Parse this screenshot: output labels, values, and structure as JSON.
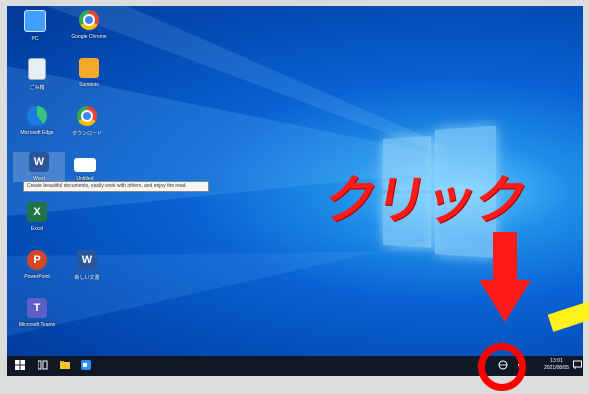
{
  "desktop": {
    "icons": [
      {
        "label": "PC",
        "icon": "pc-icon"
      },
      {
        "label": "Google Chrome",
        "icon": "chrome-icon"
      },
      {
        "label": "ごみ箱",
        "icon": "recycle-bin-icon"
      },
      {
        "label": "Sumitoto",
        "icon": "folder-app-icon"
      },
      {
        "label": "Microsoft Edge",
        "icon": "edge-icon"
      },
      {
        "label": "ダウンロード",
        "icon": "chrome-icon"
      },
      {
        "label": "Word",
        "icon": "word-icon"
      },
      {
        "label": "Untitled",
        "icon": "blank-document-icon"
      },
      {
        "label": "Excel",
        "icon": "excel-icon"
      },
      {
        "label": "PowerPoint",
        "icon": "powerpoint-icon"
      },
      {
        "label": "新しい文書",
        "icon": "word-doc-icon"
      },
      {
        "label": "Microsoft Teams",
        "icon": "teams-icon"
      }
    ],
    "tooltip": "Create beautiful documents, easily work with others, and enjoy the read."
  },
  "annotation": {
    "callout_text": "クリック",
    "callout_color": "#ff1a1a"
  },
  "taskbar": {
    "time": "13:01",
    "date": "2021/08/05"
  }
}
